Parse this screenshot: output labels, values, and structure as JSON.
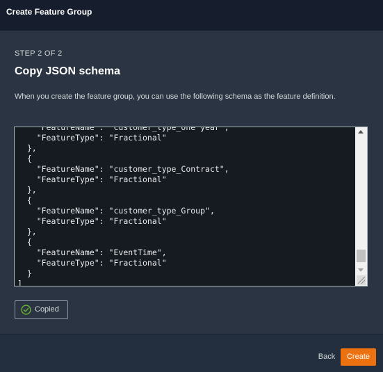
{
  "window": {
    "title": "Create Feature Group"
  },
  "step": {
    "indicator": "STEP 2 OF 2",
    "heading": "Copy JSON schema",
    "description": "When you create the feature group, you can use the following schema as the feature definition."
  },
  "schema": {
    "text": "    \"FeatureName\": \"customer_type_One year\",\n    \"FeatureType\": \"Fractional\"\n  },\n  {\n    \"FeatureName\": \"customer_type_Contract\",\n    \"FeatureType\": \"Fractional\"\n  },\n  {\n    \"FeatureName\": \"customer_type_Group\",\n    \"FeatureType\": \"Fractional\"\n  },\n  {\n    \"FeatureName\": \"EventTime\",\n    \"FeatureType\": \"Fractional\"\n  }\n]"
  },
  "copy_button": {
    "label": "Copied",
    "icon": "check-circle-icon",
    "icon_color": "#1d8102"
  },
  "footer": {
    "back_label": "Back",
    "create_label": "Create"
  },
  "colors": {
    "accent": "#ec7211",
    "success": "#6aaf35"
  }
}
